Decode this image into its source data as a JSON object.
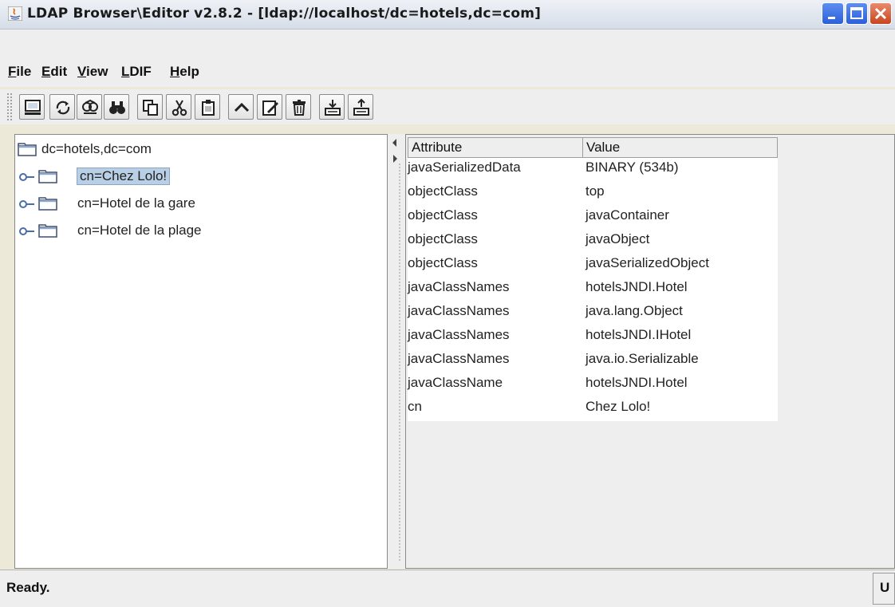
{
  "window": {
    "title": "LDAP Browser\\Editor v2.8.2 - [ldap://localhost/dc=hotels,dc=com]"
  },
  "menu": [
    {
      "mnemonic": "F",
      "rest": "ile"
    },
    {
      "mnemonic": "E",
      "rest": "dit"
    },
    {
      "mnemonic": "V",
      "rest": "iew"
    },
    {
      "mnemonic": "L",
      "rest": "DIF"
    },
    {
      "mnemonic": "H",
      "rest": "elp"
    }
  ],
  "toolbar": [
    {
      "icon": "connect-icon"
    },
    {
      "icon": "refresh-icon"
    },
    {
      "icon": "search-icon"
    },
    {
      "icon": "find-icon"
    },
    {
      "icon": "copy-icon"
    },
    {
      "icon": "cut-icon"
    },
    {
      "icon": "paste-icon"
    },
    {
      "icon": "up-icon"
    },
    {
      "icon": "edit-icon"
    },
    {
      "icon": "delete-icon"
    },
    {
      "icon": "import-icon"
    },
    {
      "icon": "export-icon"
    }
  ],
  "tree": {
    "root": "dc=hotels,dc=com",
    "children": [
      "cn=Chez Lolo!",
      "cn=Hotel de la gare",
      "cn=Hotel de la plage"
    ],
    "selected": "cn=Chez Lolo!"
  },
  "table": {
    "headers": {
      "attribute": "Attribute",
      "value": "Value"
    },
    "rows": [
      {
        "attribute": "javaSerializedData",
        "value": "BINARY (534b)"
      },
      {
        "attribute": "objectClass",
        "value": "top"
      },
      {
        "attribute": "objectClass",
        "value": "javaContainer"
      },
      {
        "attribute": "objectClass",
        "value": "javaObject"
      },
      {
        "attribute": "objectClass",
        "value": "javaSerializedObject"
      },
      {
        "attribute": "javaClassNames",
        "value": "hotelsJNDI.Hotel"
      },
      {
        "attribute": "javaClassNames",
        "value": "java.lang.Object"
      },
      {
        "attribute": "javaClassNames",
        "value": "hotelsJNDI.IHotel"
      },
      {
        "attribute": "javaClassNames",
        "value": "java.io.Serializable"
      },
      {
        "attribute": "javaClassName",
        "value": "hotelsJNDI.Hotel"
      },
      {
        "attribute": "cn",
        "value": "Chez Lolo!"
      }
    ]
  },
  "status": {
    "text": "Ready.",
    "right": "U"
  }
}
